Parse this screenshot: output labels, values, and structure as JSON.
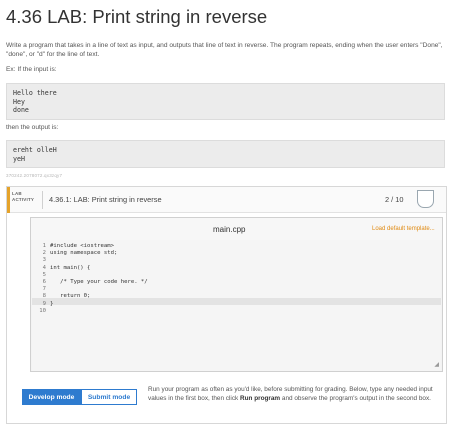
{
  "page": {
    "title": "4.36 LAB: Print string in reverse",
    "description": "Write a program that takes in a line of text as input, and outputs that line of text in reverse. The program repeats, ending when the user enters \"Done\", \"done\", or \"d\" for the line of text.",
    "example_intro": "Ex: If the input is:",
    "example_input": "Hello there\nHey\ndone",
    "then_text": "then the output is:",
    "example_output": "ereht olleH\nyeH",
    "hash": "370242.2078072.qx3zqy7"
  },
  "activity": {
    "tag_line1": "LAB",
    "tag_line2": "ACTIVITY",
    "name": "4.36.1: LAB: Print string in reverse",
    "score": "2 / 10",
    "accent_color": "#e5a32a"
  },
  "editor": {
    "filename": "main.cpp",
    "load_template": "Load default template...",
    "line_numbers": [
      "1",
      "2",
      "3",
      "4",
      "5",
      "6",
      "7",
      "8",
      "9",
      "10"
    ],
    "lines": [
      "#include <iostream>",
      "using namespace std;",
      "",
      "int main() {",
      "",
      "   /* Type your code here. */",
      "",
      "   return 0;",
      "}",
      ""
    ]
  },
  "controls": {
    "develop_mode": "Develop mode",
    "submit_mode": "Submit mode",
    "help_part1": "Run your program as often as you'd like, before submitting for grading. Below, type any needed input values in the first box, then click ",
    "help_bold": "Run program",
    "help_part2": " and observe the program's output in the second box.",
    "primary_color": "#2e7bcf"
  }
}
